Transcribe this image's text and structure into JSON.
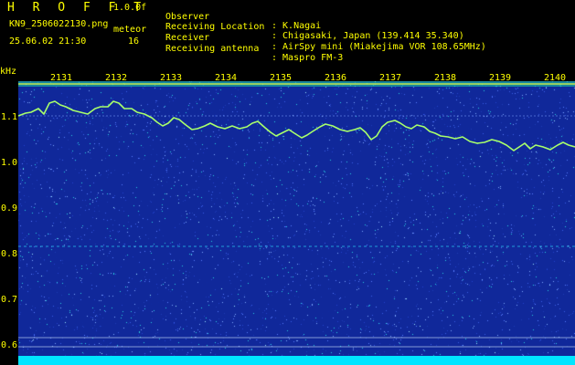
{
  "header": {
    "app_title": "H R O F F T",
    "version": "1.0.0f",
    "file_name": "KN9_2506022130.png",
    "mode_label": "meteor",
    "timestamp": "25.06.02 21:30",
    "mode_value": "16"
  },
  "info": [
    {
      "key": "Observer",
      "value": ": K.Nagai"
    },
    {
      "key": "Receiving Location",
      "value": ": Chigasaki, Japan (139.414 35.340)"
    },
    {
      "key": "Receiver",
      "value": ": AirSpy mini (Miakejima VOR 108.65MHz)"
    },
    {
      "key": "Receiving antenna",
      "value": ": Maspro FM-3"
    }
  ],
  "axis": {
    "y_unit": "kHz",
    "y_ticks": [
      "1.1",
      "1.0",
      "0.9",
      "0.8",
      "0.7",
      "0.6"
    ],
    "x_ticks": [
      "2131",
      "2132",
      "2133",
      "2134",
      "2135",
      "2136",
      "2137",
      "2138",
      "2139",
      "2140"
    ]
  },
  "colors": {
    "title": "#ffff00",
    "text": "#ffffff",
    "background": "#000000",
    "spectrogram_bg": "#10289a",
    "bottom_band": "#00e5ff"
  }
}
